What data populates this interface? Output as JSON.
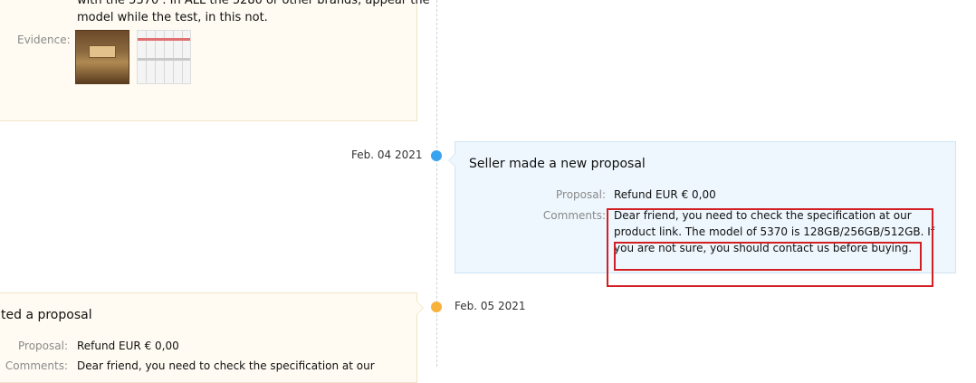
{
  "buyer_top": {
    "text_line_1": "with the 5370 . In ALL the 5280 or other brands, appear the",
    "text_line_2": "model while the test, in this not.",
    "evidence_label": "Evidence:"
  },
  "timeline": {
    "entries": [
      {
        "date": "Feb. 04 2021",
        "title": "Seller made a new proposal",
        "proposal_label": "Proposal:",
        "proposal_value": "Refund EUR € 0,00",
        "comments_label": "Comments:",
        "comments_lines": [
          "Dear friend, you need to check the specification at our",
          "product link. The model of 5370 is 128GB/256GB/512GB. If",
          "you are not sure, you should contact us before buying."
        ],
        "accent_color": "#3aa3f0"
      },
      {
        "date": "Feb. 05 2021",
        "title": "ted a proposal",
        "proposal_label": "Proposal:",
        "proposal_value": "Refund EUR € 0,00",
        "comments_label": "Comments:",
        "comments_line_partial": "Dear friend, you need to check the specification at our",
        "accent_color": "#f7b23b"
      }
    ]
  },
  "annotation": {
    "color": "#d21f24"
  }
}
